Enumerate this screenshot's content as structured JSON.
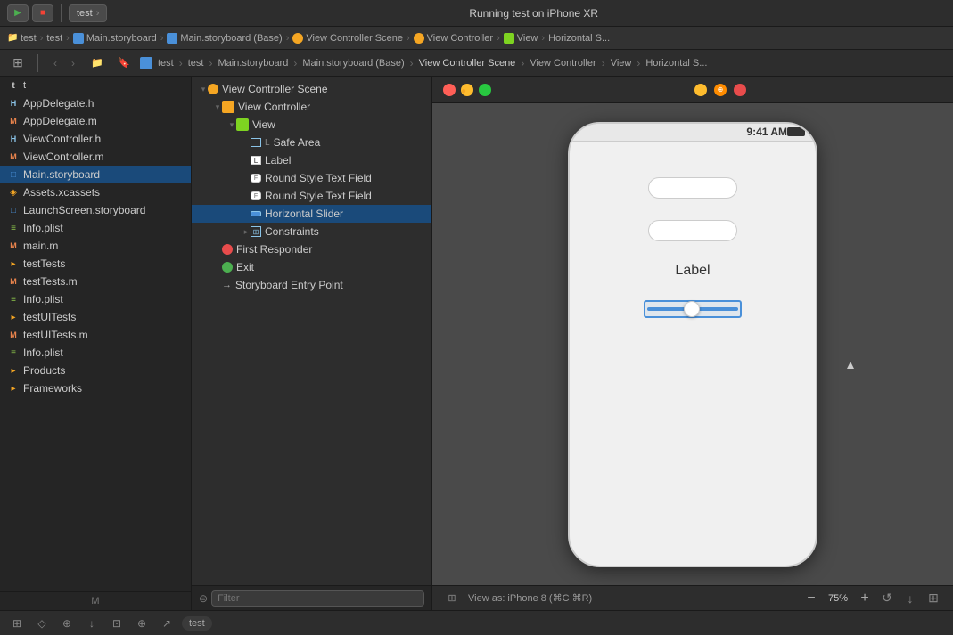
{
  "toolbar": {
    "run_label": "▶",
    "stop_label": "■",
    "running_text": "Running test on iPhone XR",
    "scheme": "test",
    "device": "iPhone XR"
  },
  "breadcrumb": {
    "items": [
      {
        "label": "test",
        "type": "folder"
      },
      {
        "label": "test",
        "type": "folder"
      },
      {
        "label": "Main.storyboard",
        "type": "storyboard"
      },
      {
        "label": "Main.storyboard (Base)",
        "type": "storyboard"
      },
      {
        "label": "View Controller Scene",
        "type": "scene"
      },
      {
        "label": "View Controller",
        "type": "vc"
      },
      {
        "label": "View",
        "type": "view"
      },
      {
        "label": "Horizontal S...",
        "type": "slider"
      }
    ],
    "separator": "›"
  },
  "sidebar": {
    "items": [
      {
        "label": "t",
        "type": "file",
        "indent": 0
      },
      {
        "label": "AppDelegate.h",
        "type": "h-file",
        "indent": 0
      },
      {
        "label": "AppDelegate.m",
        "type": "m-file",
        "indent": 0
      },
      {
        "label": "ViewController.h",
        "type": "h-file",
        "indent": 0
      },
      {
        "label": "ViewController.m",
        "type": "m-file",
        "indent": 0
      },
      {
        "label": "Main.storyboard",
        "type": "storyboard",
        "indent": 0,
        "selected": true
      },
      {
        "label": "Assets.xcassets",
        "type": "xcassets",
        "indent": 0
      },
      {
        "label": "LaunchScreen.storyboard",
        "type": "storyboard",
        "indent": 0
      },
      {
        "label": "Info.plist",
        "type": "plist",
        "indent": 0
      },
      {
        "label": "main.m",
        "type": "m-file",
        "indent": 0
      },
      {
        "label": "testTests",
        "type": "folder",
        "indent": 0
      },
      {
        "label": "testTests.m",
        "type": "m-file",
        "indent": 0
      },
      {
        "label": "Info.plist",
        "type": "plist",
        "indent": 0
      },
      {
        "label": "testUITests",
        "type": "folder",
        "indent": 0
      },
      {
        "label": "testUITests.m",
        "type": "m-file",
        "indent": 0
      },
      {
        "label": "Info.plist",
        "type": "plist",
        "indent": 0
      },
      {
        "label": "Products",
        "type": "folder",
        "indent": 0
      },
      {
        "label": "Frameworks",
        "type": "folder",
        "indent": 0
      }
    ]
  },
  "tree": {
    "items": [
      {
        "label": "View Controller Scene",
        "type": "scene",
        "indent": 0,
        "expanded": true
      },
      {
        "label": "View Controller",
        "type": "vc",
        "indent": 1,
        "expanded": true
      },
      {
        "label": "View",
        "type": "view",
        "indent": 2,
        "expanded": true
      },
      {
        "label": "Safe Area",
        "type": "safe-area",
        "indent": 3
      },
      {
        "label": "Label",
        "type": "label",
        "indent": 3
      },
      {
        "label": "Round Style Text Field",
        "type": "text-field",
        "indent": 3
      },
      {
        "label": "Round Style Text Field",
        "type": "text-field",
        "indent": 3
      },
      {
        "label": "Horizontal Slider",
        "type": "slider",
        "indent": 3,
        "selected": true
      },
      {
        "label": "Constraints",
        "type": "constraints",
        "indent": 3,
        "expanded": false
      },
      {
        "label": "First Responder",
        "type": "responder",
        "indent": 1
      },
      {
        "label": "Exit",
        "type": "exit",
        "indent": 1
      },
      {
        "label": "Storyboard Entry Point",
        "type": "entry-point",
        "indent": 1
      }
    ]
  },
  "filter": {
    "placeholder": "Filter"
  },
  "canvas": {
    "dots": [
      "red",
      "yellow",
      "green"
    ],
    "iphone": {
      "status_time": "9:41 AM",
      "label_text": "Label",
      "view_as_label": "View as: iPhone 8 (⌘C ⌘R)",
      "zoom_level": "75%",
      "zoom_minus": "−",
      "zoom_plus": "+"
    },
    "entry_arrow": "→"
  },
  "bottom_toolbar": {
    "device_label": "test",
    "icons": [
      "⊞",
      "◇",
      "⊕",
      "↓",
      "⊡",
      "⊕",
      "↗"
    ]
  }
}
